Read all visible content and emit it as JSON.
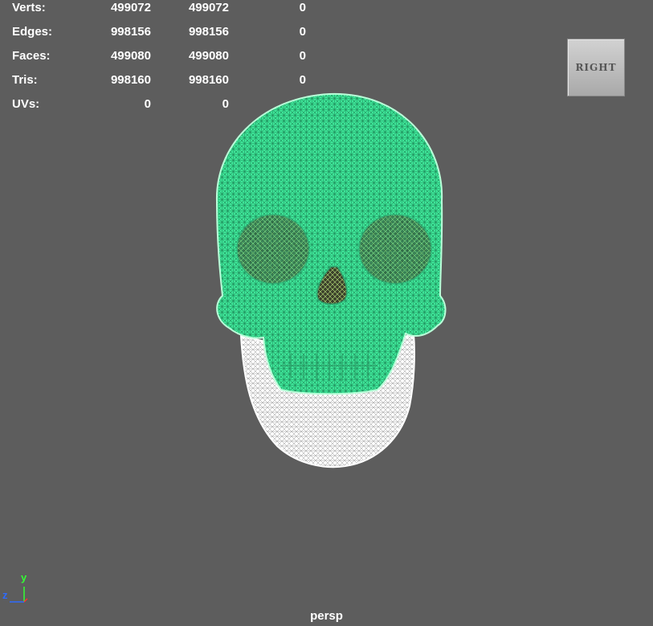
{
  "hud": {
    "rows": [
      {
        "label": "Verts:",
        "v1": "499072",
        "v2": "499072",
        "v3": "0"
      },
      {
        "label": "Edges:",
        "v1": "998156",
        "v2": "998156",
        "v3": "0"
      },
      {
        "label": "Faces:",
        "v1": "499080",
        "v2": "499080",
        "v3": "0"
      },
      {
        "label": "Tris:",
        "v1": "998160",
        "v2": "998160",
        "v3": "0"
      },
      {
        "label": "UVs:",
        "v1": "0",
        "v2": "0",
        "v3": "0"
      }
    ]
  },
  "viewcube": {
    "face_label": "RIGHT"
  },
  "axis": {
    "y": "y",
    "z": "z",
    "y_color": "#33ff33",
    "z_color": "#2e6bff",
    "x_color": "#ff3030"
  },
  "camera": {
    "name": "persp"
  },
  "colors": {
    "background": "#5d5d5d",
    "selected_wire": "#45f0a0",
    "unselected_wire": "#ffffff"
  }
}
